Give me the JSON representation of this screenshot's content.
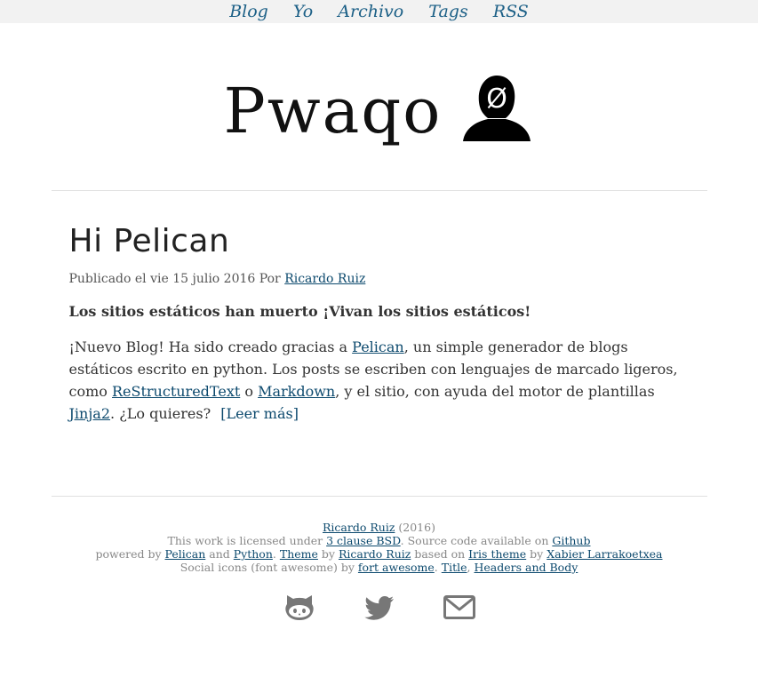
{
  "nav": {
    "items": [
      "Blog",
      "Yo",
      "Archivo",
      "Tags",
      "RSS"
    ]
  },
  "site": {
    "title": "Pwaqo",
    "logo_glyph": "Ø",
    "logo_icon": "person-silhouette-icon"
  },
  "post": {
    "title": "Hi Pelican",
    "meta_prefix": "Publicado el vie 15 julio 2016 Por",
    "author": "Ricardo Ruiz",
    "lead": "Los sitios estáticos han muerto ¡Vivan los sitios estáticos!",
    "body": {
      "p1": "¡Nuevo Blog! Ha sido creado gracias a",
      "link_pelican": "Pelican",
      "p2": ", un simple generador de blogs estáticos escrito en python. Los posts se escriben con lenguajes de marcado ligeros, como",
      "link_rst": "ReStructuredText",
      "p3": "o",
      "link_markdown": "Markdown",
      "p4": ", y el sitio, con ayuda del motor de plantillas",
      "link_jinja": "Jinja2",
      "p5": ". ¿Lo quieres?"
    },
    "read_more": "[Leer más]"
  },
  "footer": {
    "line1": {
      "author": "Ricardo Ruiz",
      "year": "(2016)"
    },
    "line2": {
      "t1": "This work is licensed under",
      "license": "3 clause BSD",
      "t2": ". Source code available on",
      "source": "Github"
    },
    "line3": {
      "t1": "powered by",
      "pelican": "Pelican",
      "t2": "and",
      "python": "Python",
      "t3": ".",
      "theme": "Theme",
      "t4": "by",
      "theme_author": "Ricardo Ruiz",
      "t5": "based on",
      "iris": "Iris theme",
      "t6": "by",
      "iris_author": "Xabier Larrakoetxea"
    },
    "line4": {
      "t1": "Social icons (font awesome) by",
      "fa": "fort awesome",
      "t2": ".",
      "title": "Title",
      "t3": ",",
      "headers": "Headers and Body"
    },
    "social_icons": [
      "github-icon",
      "twitter-icon",
      "email-icon"
    ]
  },
  "colors": {
    "link": "#0d4a6e",
    "nav_link": "#1b5f86",
    "nav_bg": "#f2f2f2",
    "icon_gray": "#777777"
  }
}
